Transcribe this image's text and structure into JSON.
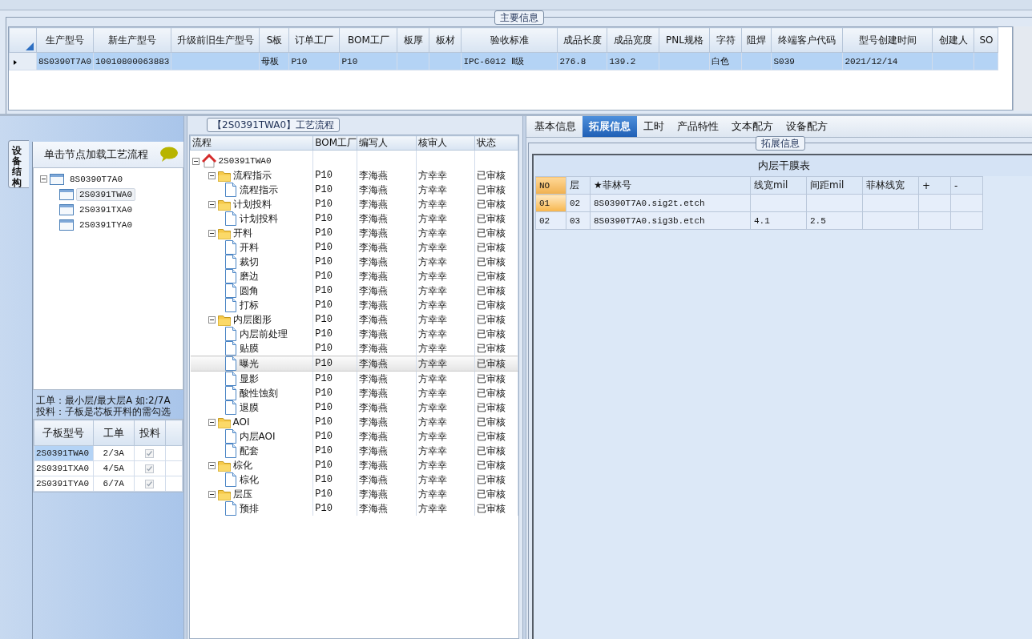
{
  "main_info": {
    "title": "主要信息",
    "columns": [
      "生产型号",
      "新生产型号",
      "升级前旧生产型号",
      "S板",
      "订单工厂",
      "BOM工厂",
      "板厚",
      "板材",
      "验收标准",
      "成品长度",
      "成品宽度",
      "PNL规格",
      "字符",
      "阻焊",
      "终端客户代码",
      "型号创建时间",
      "创建人",
      "SO"
    ],
    "rows": [
      {
        "selected": true,
        "cells": [
          "8S0390T7A0",
          "10010800063883",
          null,
          "母板",
          "P10",
          "P10",
          null,
          null,
          "IPC-6012 Ⅱ级",
          "276.8",
          "139.2",
          null,
          "白色",
          null,
          "S039",
          "2021/12/14",
          null,
          null
        ]
      }
    ]
  },
  "left_panel": {
    "side_tab": "设备结构",
    "header": "单击节点加载工艺流程",
    "tree": {
      "label": "8S0390T7A0",
      "expanded": true,
      "selected": false,
      "children": [
        {
          "label": "2S0391TWA0",
          "selected": true
        },
        {
          "label": "2S0391TXA0",
          "selected": false
        },
        {
          "label": "2S0391TYA0",
          "selected": false
        }
      ]
    },
    "notes": [
      "工单：最小层/最大层A 如:2/7A",
      "投料：子板是芯板开料的需勾选"
    ],
    "sub_table": {
      "columns": [
        "子板型号",
        "工单",
        "投料"
      ],
      "rows": [
        {
          "model": "2S0391TWA0",
          "order": "2/3A",
          "checked": true,
          "selected": true
        },
        {
          "model": "2S0391TXA0",
          "order": "4/5A",
          "checked": true,
          "selected": false
        },
        {
          "model": "2S0391TYA0",
          "order": "6/7A",
          "checked": true,
          "selected": false
        }
      ]
    }
  },
  "process_panel": {
    "title": "【2S0391TWA0】工艺流程",
    "columns": [
      "流程",
      "BOM工厂",
      "编写人",
      "核审人",
      "状态"
    ],
    "root": {
      "label": "2S0391TWA0",
      "expanded": true,
      "children": [
        {
          "label": "流程指示",
          "bom": "P10",
          "writer": "李海燕",
          "reviewer": "方幸幸",
          "status": "已审核",
          "expanded": true,
          "selected": false,
          "children": [
            {
              "label": "流程指示",
              "bom": "P10",
              "writer": "李海燕",
              "reviewer": "方幸幸",
              "status": "已审核",
              "selected": false
            }
          ]
        },
        {
          "label": "计划投料",
          "bom": "P10",
          "writer": "李海燕",
          "reviewer": "方幸幸",
          "status": "已审核",
          "expanded": true,
          "selected": false,
          "children": [
            {
              "label": "计划投料",
              "bom": "P10",
              "writer": "李海燕",
              "reviewer": "方幸幸",
              "status": "已审核",
              "selected": false
            }
          ]
        },
        {
          "label": "开料",
          "bom": "P10",
          "writer": "李海燕",
          "reviewer": "方幸幸",
          "status": "已审核",
          "expanded": true,
          "selected": false,
          "children": [
            {
              "label": "开料",
              "bom": "P10",
              "writer": "李海燕",
              "reviewer": "方幸幸",
              "status": "已审核",
              "selected": false
            },
            {
              "label": "裁切",
              "bom": "P10",
              "writer": "李海燕",
              "reviewer": "方幸幸",
              "status": "已审核",
              "selected": false
            },
            {
              "label": "磨边",
              "bom": "P10",
              "writer": "李海燕",
              "reviewer": "方幸幸",
              "status": "已审核",
              "selected": false
            },
            {
              "label": "圆角",
              "bom": "P10",
              "writer": "李海燕",
              "reviewer": "方幸幸",
              "status": "已审核",
              "selected": false
            },
            {
              "label": "打标",
              "bom": "P10",
              "writer": "李海燕",
              "reviewer": "方幸幸",
              "status": "已审核",
              "selected": false
            }
          ]
        },
        {
          "label": "内层图形",
          "bom": "P10",
          "writer": "李海燕",
          "reviewer": "方幸幸",
          "status": "已审核",
          "expanded": true,
          "selected": false,
          "children": [
            {
              "label": "内层前处理",
              "bom": "P10",
              "writer": "李海燕",
              "reviewer": "方幸幸",
              "status": "已审核",
              "selected": false
            },
            {
              "label": "贴膜",
              "bom": "P10",
              "writer": "李海燕",
              "reviewer": "方幸幸",
              "status": "已审核",
              "selected": false
            },
            {
              "label": "曝光",
              "bom": "P10",
              "writer": "李海燕",
              "reviewer": "方幸幸",
              "status": "已审核",
              "selected": true
            },
            {
              "label": "显影",
              "bom": "P10",
              "writer": "李海燕",
              "reviewer": "方幸幸",
              "status": "已审核",
              "selected": false
            },
            {
              "label": "酸性蚀刻",
              "bom": "P10",
              "writer": "李海燕",
              "reviewer": "方幸幸",
              "status": "已审核",
              "selected": false
            },
            {
              "label": "退膜",
              "bom": "P10",
              "writer": "李海燕",
              "reviewer": "方幸幸",
              "status": "已审核",
              "selected": false
            }
          ]
        },
        {
          "label": "AOI",
          "bom": "P10",
          "writer": "李海燕",
          "reviewer": "方幸幸",
          "status": "已审核",
          "expanded": true,
          "selected": false,
          "children": [
            {
              "label": "内层AOI",
              "bom": "P10",
              "writer": "李海燕",
              "reviewer": "方幸幸",
              "status": "已审核",
              "selected": false
            },
            {
              "label": "配套",
              "bom": "P10",
              "writer": "李海燕",
              "reviewer": "方幸幸",
              "status": "已审核",
              "selected": false
            }
          ]
        },
        {
          "label": "棕化",
          "bom": "P10",
          "writer": "李海燕",
          "reviewer": "方幸幸",
          "status": "已审核",
          "expanded": true,
          "selected": false,
          "children": [
            {
              "label": "棕化",
              "bom": "P10",
              "writer": "李海燕",
              "reviewer": "方幸幸",
              "status": "已审核",
              "selected": false
            }
          ]
        },
        {
          "label": "层压",
          "bom": "P10",
          "writer": "李海燕",
          "reviewer": "方幸幸",
          "status": "已审核",
          "expanded": true,
          "selected": false,
          "children": [
            {
              "label": "预排",
              "bom": "P10",
              "writer": "李海燕",
              "reviewer": "方幸幸",
              "status": "已审核",
              "selected": false
            }
          ]
        }
      ]
    }
  },
  "detail_panel": {
    "tabs": [
      {
        "label": "基本信息",
        "selected": false
      },
      {
        "label": "拓展信息",
        "selected": true
      },
      {
        "label": "工时",
        "selected": false
      },
      {
        "label": "产品特性",
        "selected": false
      },
      {
        "label": "文本配方",
        "selected": false
      },
      {
        "label": "设备配方",
        "selected": false
      }
    ],
    "group_title": "拓展信息",
    "table_title": "内层干膜表",
    "columns": [
      "NO",
      "层",
      "★菲林号",
      "线宽mil",
      "间距mil",
      "菲林线宽",
      "+",
      "-"
    ],
    "rows": [
      {
        "selected": true,
        "cells": [
          "01",
          "02",
          "8S0390T7A0.sig2t.etch",
          null,
          null,
          null,
          null,
          null
        ]
      },
      {
        "selected": false,
        "cells": [
          "02",
          "03",
          "8S0390T7A0.sig3b.etch",
          "4.1",
          "2.5",
          null,
          null,
          null
        ]
      }
    ]
  }
}
